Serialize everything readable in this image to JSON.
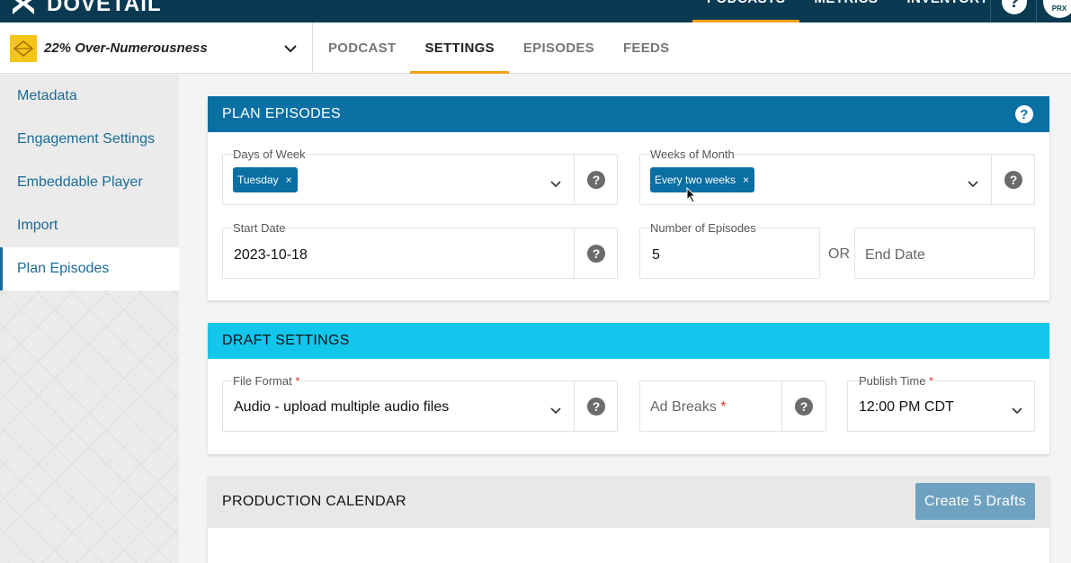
{
  "app": {
    "name": "DOVETAIL"
  },
  "topnav": {
    "items": [
      "PODCASTS",
      "METRICS",
      "INVENTORY"
    ],
    "active": "PODCASTS",
    "help": "?",
    "avatar_text": "PRX"
  },
  "podcast": {
    "name": "22% Over-Numerousness"
  },
  "subtabs": [
    "PODCAST",
    "SETTINGS",
    "EPISODES",
    "FEEDS"
  ],
  "sidebar": {
    "items": [
      {
        "label": "Metadata"
      },
      {
        "label": "Engagement Settings"
      },
      {
        "label": "Embeddable Player"
      },
      {
        "label": "Import"
      },
      {
        "label": "Plan Episodes",
        "active": true
      }
    ]
  },
  "plan": {
    "title": "PLAN EPISODES",
    "days_label": "Days of Week",
    "days_chip": "Tuesday",
    "weeks_label": "Weeks of Month",
    "weeks_chip": "Every two weeks",
    "start_label": "Start Date",
    "start_value": "2023-10-18",
    "num_label": "Number of Episodes",
    "num_value": "5",
    "or_text": "OR",
    "end_placeholder": "End Date"
  },
  "draft": {
    "title": "DRAFT SETTINGS",
    "format_label": "File Format",
    "format_value": "Audio - upload multiple audio files",
    "adbreaks_placeholder": "Ad Breaks",
    "publish_label": "Publish Time",
    "publish_value": "12:00 PM CDT",
    "required_mark": "*"
  },
  "calendar": {
    "title": "PRODUCTION CALENDAR",
    "create_button": "Create 5 Drafts"
  },
  "colors": {
    "brand_dark": "#0a3a52",
    "accent_orange": "#f4a11a",
    "plan_header": "#0a6fa3",
    "draft_header": "#13c6ec",
    "chip": "#0a6fa3"
  }
}
